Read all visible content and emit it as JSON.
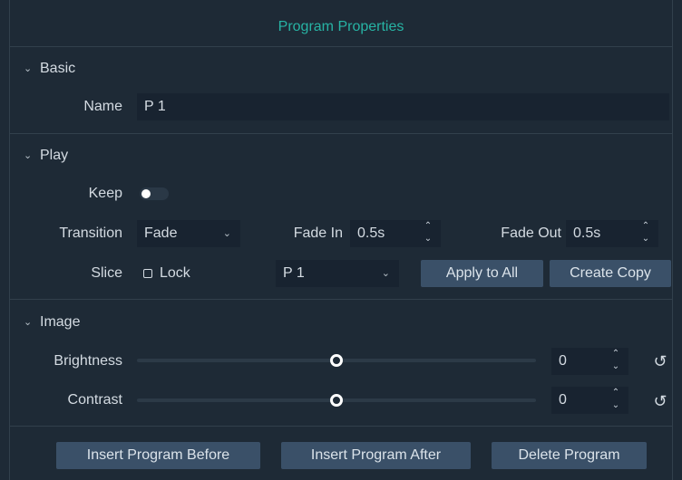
{
  "window": {
    "title": "Program Properties"
  },
  "basic": {
    "header": "Basic",
    "name_label": "Name",
    "name_value": "P 1"
  },
  "play": {
    "header": "Play",
    "keep_label": "Keep",
    "keep_on": false,
    "transition_label": "Transition",
    "transition_value": "Fade",
    "fade_in_label": "Fade In",
    "fade_in_value": "0.5s",
    "fade_out_label": "Fade Out",
    "fade_out_value": "0.5s",
    "slice_label": "Slice",
    "lock_label": "Lock",
    "slice_program": "P 1",
    "apply_all_label": "Apply to All",
    "create_copy_label": "Create Copy"
  },
  "image": {
    "header": "Image",
    "brightness_label": "Brightness",
    "brightness_value": "0",
    "brightness_level": 0.5,
    "contrast_label": "Contrast",
    "contrast_value": "0",
    "contrast_level": 0.5
  },
  "footer": {
    "insert_before_label": "Insert Program Before",
    "insert_after_label": "Insert Program After",
    "delete_label": "Delete Program"
  },
  "icons": {
    "chevron": "chevron-down-icon",
    "spin": "spin-arrows-icon",
    "reset": "reset-icon"
  },
  "colors": {
    "background": "#1e2a36",
    "title": "#27b3a4",
    "button": "#3a5068",
    "field": "#182330"
  }
}
